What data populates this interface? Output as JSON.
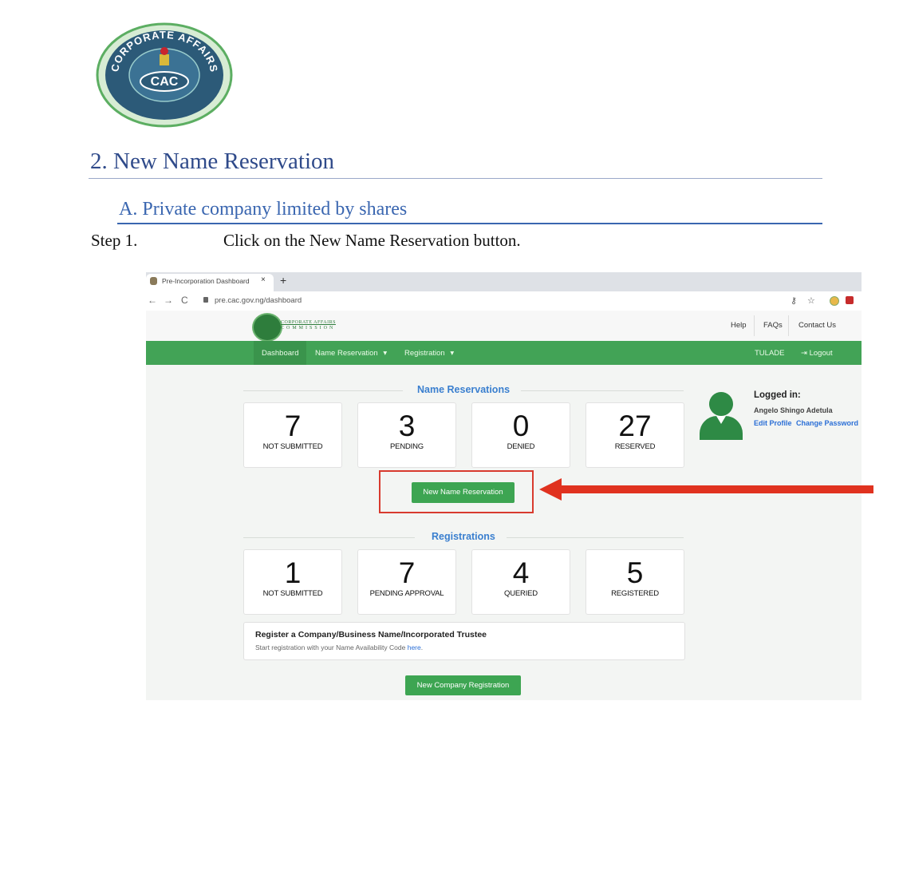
{
  "document": {
    "logo_text_ring": "CORPORATE AFFAIRS COMMISSION",
    "logo_text_center": "CAC",
    "heading_number": "2.",
    "heading": "New Name Reservation",
    "subheading_letter": "A.",
    "subheading": "Private company limited by shares",
    "step_label": "Step 1.",
    "step_text": "Click on the New Name Reservation button."
  },
  "browser": {
    "tab_title": "Pre-Incorporation Dashboard",
    "tab_close": "×",
    "new_tab": "+",
    "url": "pre.cac.gov.ng/dashboard",
    "back_icon": "←",
    "forward_icon": "→",
    "reload_icon": "C",
    "key_icon": "⚷",
    "star_icon": "☆"
  },
  "site": {
    "logo_text_line1": "CORPORATE AFFAIRS",
    "logo_text_line2": "COMMISSION",
    "top_links": [
      "Help",
      "FAQs",
      "Contact Us"
    ],
    "nav": {
      "dashboard": "Dashboard",
      "name_reservation": "Name Reservation",
      "registration": "Registration",
      "caret": "▾",
      "user": "TULADE",
      "logout_icon": "⇥",
      "logout": "Logout"
    },
    "name_reservations": {
      "title": "Name Reservations",
      "cards": [
        {
          "value": "7",
          "label": "NOT SUBMITTED"
        },
        {
          "value": "3",
          "label": "PENDING"
        },
        {
          "value": "0",
          "label": "DENIED"
        },
        {
          "value": "27",
          "label": "RESERVED"
        }
      ],
      "button": "New Name Reservation"
    },
    "registrations": {
      "title": "Registrations",
      "cards": [
        {
          "value": "1",
          "label": "NOT SUBMITTED"
        },
        {
          "value": "7",
          "label": "PENDING APPROVAL"
        },
        {
          "value": "4",
          "label": "QUERIED"
        },
        {
          "value": "5",
          "label": "REGISTERED"
        }
      ]
    },
    "register_box": {
      "title": "Register a Company/Business Name/Incorporated Trustee",
      "subtitle": "Start registration with your Name Availability Code ",
      "link": "here",
      "period": "."
    },
    "new_company_button": "New Company Registration",
    "profile": {
      "logged_in_label": "Logged in:",
      "name": "Angelo Shingo Adetula",
      "edit_profile": "Edit Profile",
      "change_password": "Change Password"
    }
  },
  "colors": {
    "heading": "#2f4a8a",
    "subheading": "#3a66b0",
    "nav_green": "#42a356",
    "highlight_red": "#d83a2e",
    "arrow_red": "#e0321f"
  }
}
